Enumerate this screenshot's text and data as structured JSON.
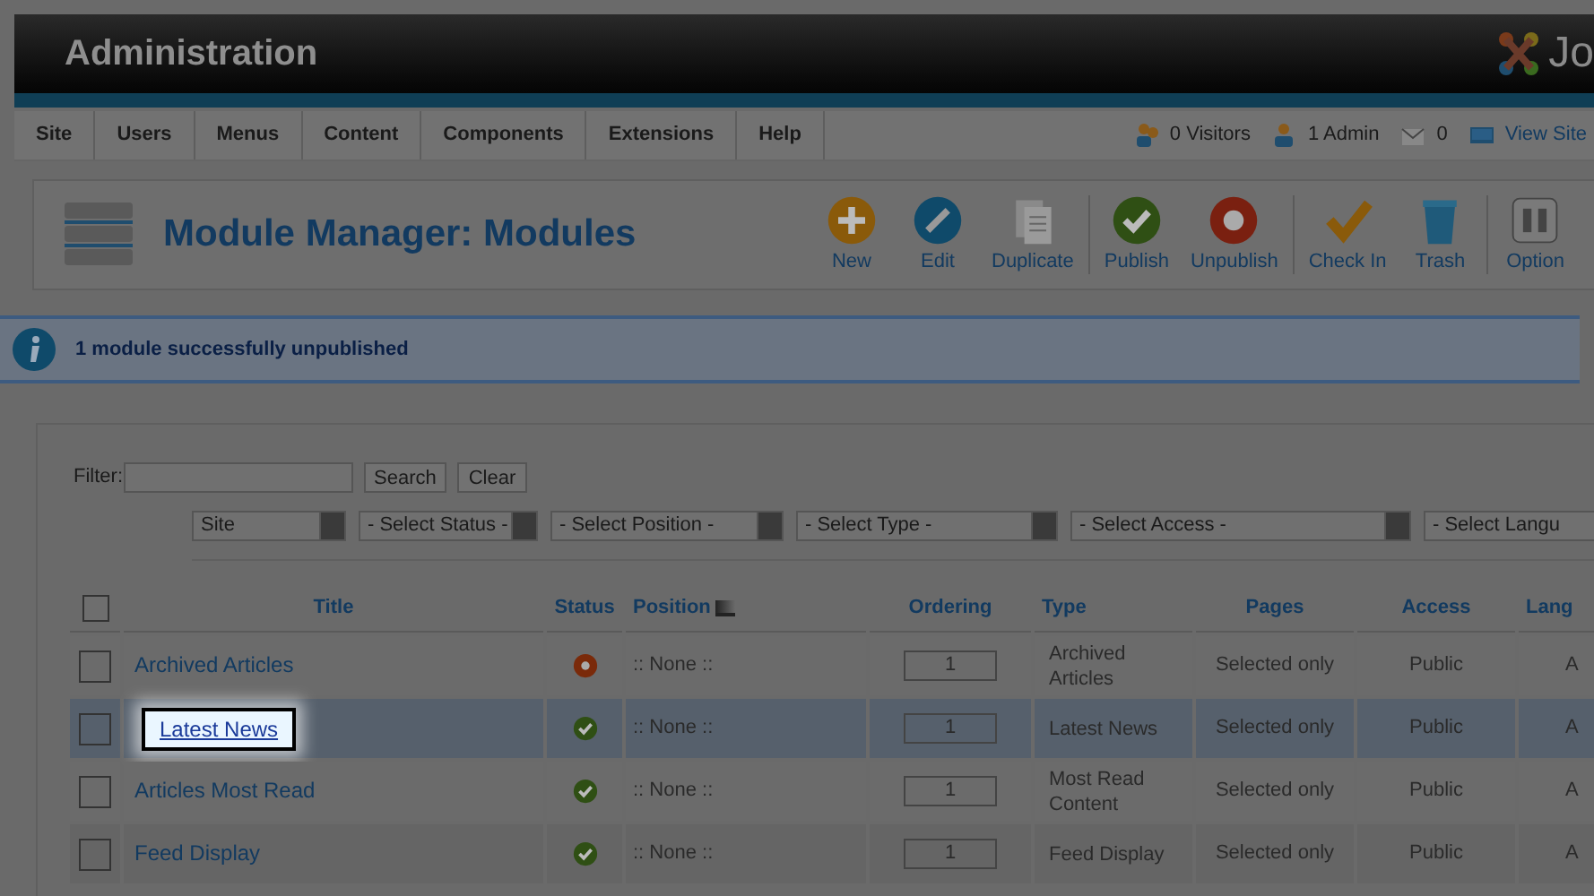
{
  "header": {
    "title": "Administration",
    "logo_text": "Jo"
  },
  "menu": [
    "Site",
    "Users",
    "Menus",
    "Content",
    "Components",
    "Extensions",
    "Help"
  ],
  "status_links": [
    {
      "kind": "visitors",
      "label": "0 Visitors"
    },
    {
      "kind": "admin",
      "label": "1 Admin"
    },
    {
      "kind": "messages",
      "label": "0"
    },
    {
      "kind": "site",
      "label": "View Site"
    }
  ],
  "page_title": "Module Manager: Modules",
  "toolbar": [
    {
      "kind": "new",
      "label": "New"
    },
    {
      "kind": "edit",
      "label": "Edit"
    },
    {
      "kind": "duplicate",
      "label": "Duplicate"
    },
    {
      "kind": "publish",
      "label": "Publish"
    },
    {
      "kind": "unpublish",
      "label": "Unpublish"
    },
    {
      "kind": "checkin",
      "label": "Check In"
    },
    {
      "kind": "trash",
      "label": "Trash"
    },
    {
      "kind": "options",
      "label": "Option"
    }
  ],
  "message": "1 module successfully unpublished",
  "filter": {
    "label": "Filter:",
    "buttons": [
      "Search",
      "Clear"
    ],
    "selects": [
      "Site",
      "- Select Status -",
      "- Select Position -",
      "- Select Type -",
      "- Select Access -",
      "- Select Langu"
    ]
  },
  "table": {
    "select_all_checked": false,
    "columns": [
      "Title",
      "Status",
      "Position",
      "Ordering",
      "Type",
      "Pages",
      "Access",
      "Lang"
    ],
    "rows": [
      {
        "checked": false,
        "selected": false,
        "callout": false,
        "title": "Archived Articles",
        "published": false,
        "position": ":: None ::",
        "ordering": "1",
        "type": "Archived Articles",
        "pages": "Selected only",
        "access": "Public",
        "language": "A"
      },
      {
        "checked": false,
        "selected": true,
        "callout": true,
        "title": "Latest News",
        "published": true,
        "position": ":: None ::",
        "ordering": "1",
        "type": "Latest News",
        "pages": "Selected only",
        "access": "Public",
        "language": "A"
      },
      {
        "checked": false,
        "selected": false,
        "callout": false,
        "title": "Articles Most Read",
        "published": true,
        "position": ":: None ::",
        "ordering": "1",
        "type": "Most Read Content",
        "pages": "Selected only",
        "access": "Public",
        "language": "A"
      },
      {
        "checked": false,
        "selected": false,
        "callout": false,
        "title": "Feed Display",
        "published": true,
        "position": ":: None ::",
        "ordering": "1",
        "type": "Feed Display",
        "pages": "Selected only",
        "access": "Public",
        "language": "A"
      }
    ]
  }
}
